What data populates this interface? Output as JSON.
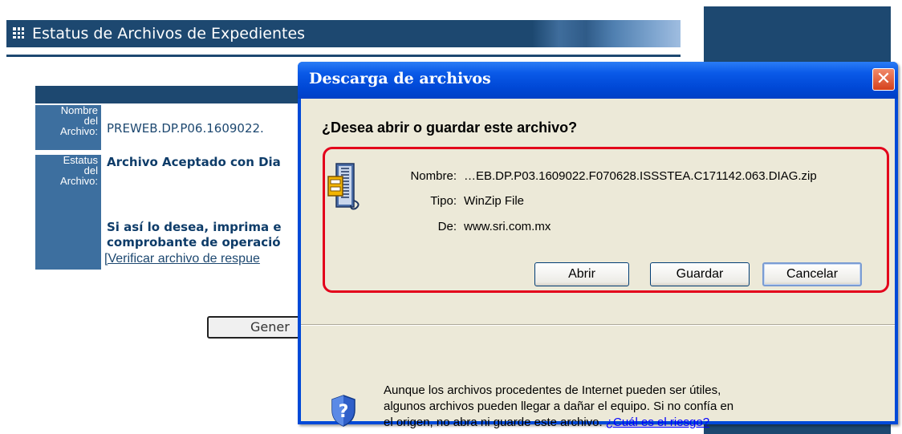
{
  "page": {
    "title": "Estatus de Archivos de Expedientes"
  },
  "form": {
    "name_label": [
      "Nombre",
      "del",
      "Archivo:"
    ],
    "status_label": [
      "Estatus",
      "del",
      "Archivo:"
    ],
    "file_name_value": "PREWEB.DP.P06.1609022.",
    "status_value": "Archivo Aceptado con Dia",
    "message_lines": [
      "Si así lo desea, imprima e",
      "comprobante de operació"
    ],
    "verify_link": "[Verificar archivo de respue",
    "generate_button": "Gener"
  },
  "dialog": {
    "title": "Descarga de archivos",
    "close_glyph": "✕",
    "question": "¿Desea abrir o guardar este archivo?",
    "fields": {
      "name_label": "Nombre:",
      "name_value": "…EB.DP.P03.1609022.F070628.ISSSTEA.C171142.063.DIAG.zip",
      "type_label": "Tipo:",
      "type_value": "WinZip File",
      "from_label": "De:",
      "from_value": "www.sri.com.mx"
    },
    "buttons": {
      "open": "Abrir",
      "save": "Guardar",
      "cancel": "Cancelar"
    },
    "warning_lines": [
      "Aunque los archivos procedentes de Internet pueden ser útiles,",
      "algunos archivos pueden llegar a dañar el equipo. Si no confía en",
      "el origen, no abra ni guarde este archivo. "
    ],
    "risk_link": "¿Cuál es el riesgo?",
    "icons": {
      "file": "winzip-icon",
      "warning": "security-shield-icon"
    }
  },
  "colors": {
    "navy": "#1d4870",
    "dialog_blue": "#0049d8",
    "highlight_red": "#e3001b",
    "dialog_face": "#ece9d8"
  }
}
